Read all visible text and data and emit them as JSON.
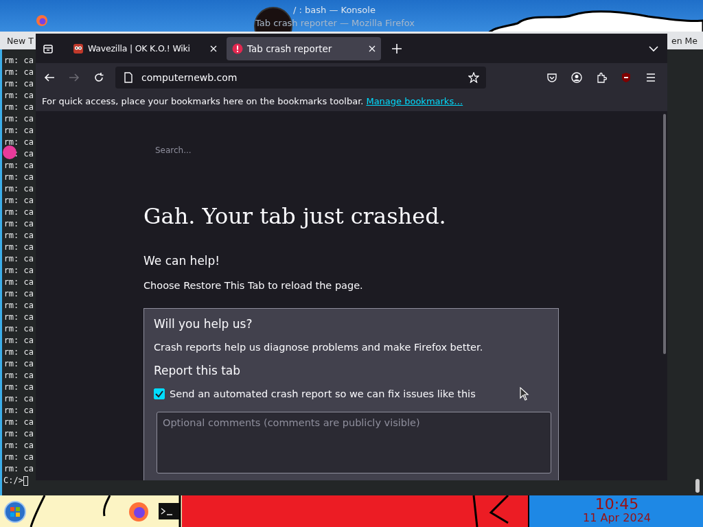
{
  "desktop": {
    "konsole_title": "/ : bash — Konsole",
    "firefox_title": "Tab crash reporter — Mozilla Firefox",
    "strip_left": "New T",
    "strip_right": "en Me"
  },
  "terminal": {
    "lines": [
      "rm: ca",
      "rm: ca",
      "rm: ca",
      "rm: ca",
      "rm: ca",
      "rm: ca",
      "rm: ca",
      "rm: ca",
      ": ca",
      "rm: ca",
      "rm: ca",
      "rm: ca",
      "rm: ca",
      "rm: ca",
      "rm: ca",
      "rm: ca",
      "rm: ca",
      "rm: ca",
      "rm: ca",
      "rm: ca",
      "rm: ca",
      "rm: ca",
      "rm: ca",
      "rm: ca",
      "rm: ca",
      "rm: ca",
      "rm: ca",
      "rm: ca",
      "rm: ca",
      "rm: ca",
      "rm: ca",
      "rm: ca",
      "rm: ca",
      "rm: ca",
      "rm: ca",
      "rm: ca"
    ],
    "prompt": "C:/>"
  },
  "browser": {
    "tabs": [
      {
        "title": "Wavezilla | OK K.O.! Wiki",
        "selected": false,
        "kind": "favicon"
      },
      {
        "title": "Tab crash reporter",
        "selected": true,
        "kind": "warning"
      }
    ],
    "nav_buttons": [
      {
        "kind": "back",
        "disabled": false
      },
      {
        "kind": "forward",
        "disabled": true
      },
      {
        "kind": "reload",
        "disabled": false
      }
    ],
    "url": "computernewb.com",
    "bookmarks_bar": {
      "text": "For quick access, place your bookmarks here on the bookmarks toolbar.",
      "link": "Manage bookmarks…"
    },
    "page": {
      "search_placeholder": "Search...",
      "title": "Gah. Your tab just crashed.",
      "subtitle": "We can help!",
      "instruction": "Choose Restore This Tab to reload the page.",
      "panel": {
        "heading": "Will you help us?",
        "text": "Crash reports help us diagnose problems and make Firefox better.",
        "report_heading": "Report this tab",
        "checkbox": {
          "label": "Send an automated crash report so we can fix issues like this",
          "checked": true
        },
        "comments_placeholder": "Optional comments (comments are publicly visible)"
      }
    }
  },
  "taskbar": {
    "time": "10:45",
    "date": "11 Apr 2024"
  }
}
